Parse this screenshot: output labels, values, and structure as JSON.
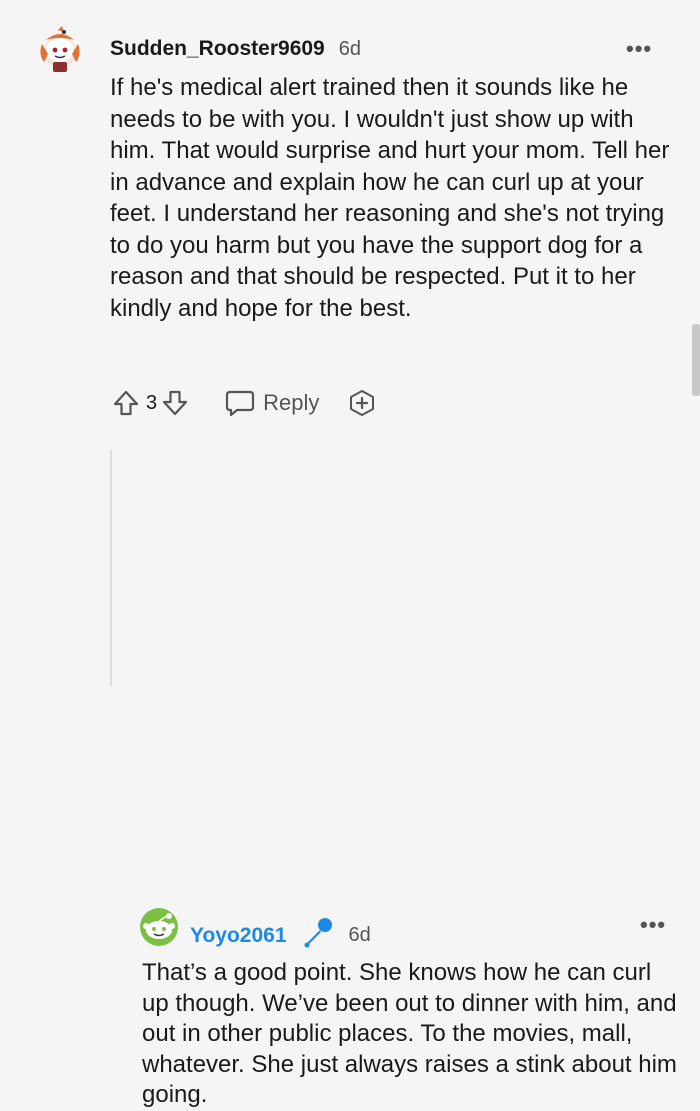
{
  "comment1": {
    "username": "Sudden_Rooster9609",
    "age": "6d",
    "more_label": "•••",
    "body": "If he's medical alert trained then it sounds like he needs to be with you. I wouldn't just show up with him. That would surprise and hurt your mom. Tell her in advance and explain how he can curl up at your feet. I understand her reasoning and she's not trying to do you harm but you have the support dog for a reason and that should be respected. Put it to her kindly and hope for the best.",
    "vote_count": "3",
    "reply_label": "Reply",
    "icons": {
      "upvote": "arrow-up-icon",
      "downvote": "arrow-down-icon",
      "reply": "speech-bubble-icon",
      "award": "plus-award-icon"
    }
  },
  "comment2": {
    "username": "Yoyo2061",
    "age": "6d",
    "more_label": "•••",
    "body": "That’s a good point. She knows how he can curl up though. We’ve been out to dinner with him, and out in other public places. To the movies, mall, whatever. She just always raises a stink about him going.",
    "flair_icon": "microphone-icon"
  },
  "colors": {
    "background": "#f5f5f5",
    "username_blue": "#1e88e5",
    "text": "#1a1a1b",
    "muted": "#555555"
  }
}
